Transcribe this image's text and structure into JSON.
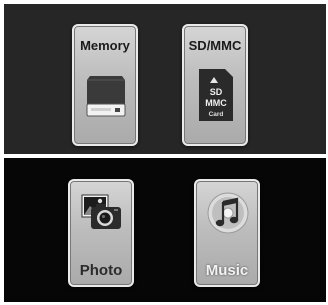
{
  "menu": {
    "top_row": [
      {
        "id": "memory",
        "label": "Memory",
        "icon": "internal-memory-icon"
      },
      {
        "id": "sdmmc",
        "label": "SD/MMC",
        "icon": "sd-card-icon",
        "icon_text": [
          "SD",
          "MMC",
          "Card"
        ]
      }
    ],
    "bottom_row": [
      {
        "id": "photo",
        "label": "Photo",
        "icon": "photo-camera-icon"
      },
      {
        "id": "music",
        "label": "Music",
        "icon": "music-note-icon"
      }
    ]
  },
  "colors": {
    "top_panel_bg": "#262626",
    "bottom_panel_bg": "#060606",
    "tile_face": "#c4c4c4",
    "music_label": "#f3f3f3"
  }
}
